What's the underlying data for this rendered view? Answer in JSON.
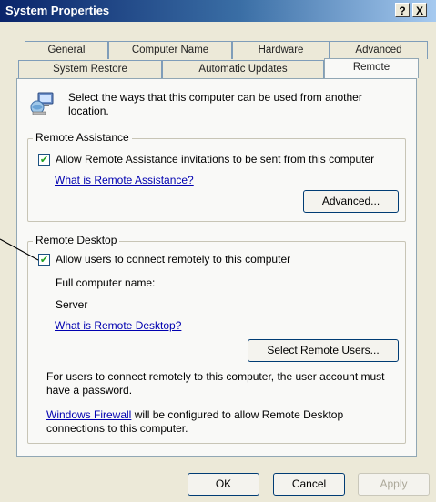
{
  "window": {
    "title": "System Properties",
    "help_btn": "?",
    "close_btn": "X"
  },
  "tabs_row1": [
    "General",
    "Computer Name",
    "Hardware",
    "Advanced"
  ],
  "tabs_row2": [
    "System Restore",
    "Automatic Updates",
    "Remote"
  ],
  "intro": {
    "text_line1": "Select the ways that this computer can be used from another",
    "text_line2": "location.",
    "icon": "computer-network-icon"
  },
  "remote_assistance": {
    "label": "Remote Assistance",
    "checkbox_label": "Allow Remote Assistance invitations to be sent from this computer",
    "checked": true,
    "link": "What is Remote Assistance?",
    "advanced_button": "Advanced..."
  },
  "remote_desktop": {
    "label": "Remote Desktop",
    "checkbox_label": "Allow users to connect remotely to this computer",
    "checked": true,
    "full_name_label": "Full computer name:",
    "full_name_value": "Server",
    "link": "What is Remote Desktop?",
    "select_users_button": "Select Remote Users...",
    "note_line1": "For users to connect remotely to this computer, the user account must",
    "note_line2": "have a password.",
    "firewall_link": "Windows Firewall",
    "firewall_text": "will be configured to allow Remote Desktop",
    "firewall_line2": "connections to this computer."
  },
  "buttons": {
    "ok": "OK",
    "cancel": "Cancel",
    "apply": "Apply"
  }
}
